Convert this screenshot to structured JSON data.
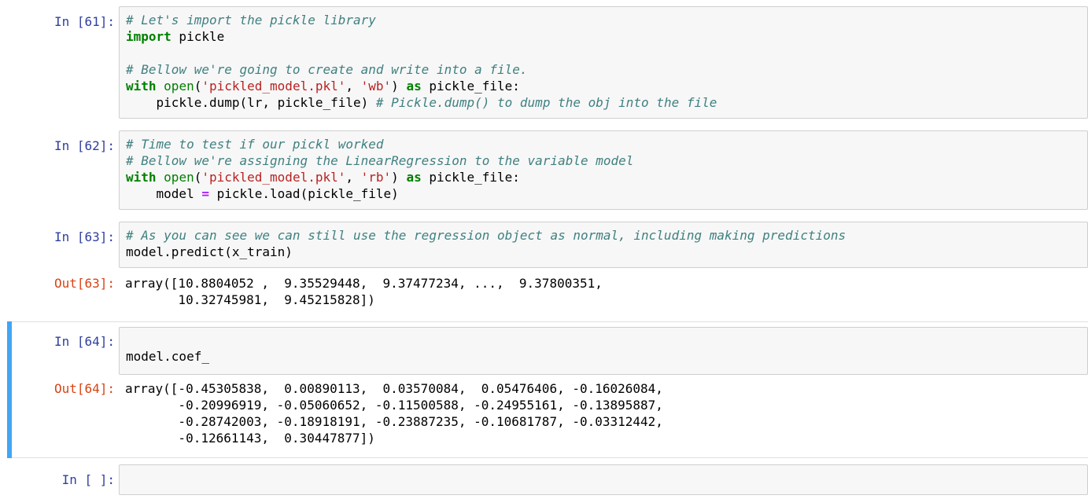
{
  "cells": [
    {
      "prompt": "In [61]:",
      "lines": [
        [
          {
            "t": "# Let's import the pickle library",
            "c": "cm"
          }
        ],
        [
          {
            "t": "import",
            "c": "kw"
          },
          {
            "t": " pickle",
            "c": ""
          }
        ],
        [],
        [
          {
            "t": "# Bellow we're going to create and write into a file.",
            "c": "cm"
          }
        ],
        [
          {
            "t": "with",
            "c": "kw"
          },
          {
            "t": " ",
            "c": ""
          },
          {
            "t": "open",
            "c": "bi"
          },
          {
            "t": "(",
            "c": ""
          },
          {
            "t": "'pickled_model.pkl'",
            "c": "st"
          },
          {
            "t": ", ",
            "c": ""
          },
          {
            "t": "'wb'",
            "c": "st"
          },
          {
            "t": ") ",
            "c": ""
          },
          {
            "t": "as",
            "c": "kw"
          },
          {
            "t": " pickle_file:",
            "c": ""
          }
        ],
        [
          {
            "t": "    pickle.dump(lr, pickle_file) ",
            "c": ""
          },
          {
            "t": "# Pickle.dump() to dump the obj into the file",
            "c": "cm"
          }
        ]
      ]
    },
    {
      "prompt": "In [62]:",
      "lines": [
        [
          {
            "t": "# Time to test if our pickl worked",
            "c": "cm"
          }
        ],
        [
          {
            "t": "# Bellow we're assigning the LinearRegression to the variable model",
            "c": "cm"
          }
        ],
        [
          {
            "t": "with",
            "c": "kw"
          },
          {
            "t": " ",
            "c": ""
          },
          {
            "t": "open",
            "c": "bi"
          },
          {
            "t": "(",
            "c": ""
          },
          {
            "t": "'pickled_model.pkl'",
            "c": "st"
          },
          {
            "t": ", ",
            "c": ""
          },
          {
            "t": "'rb'",
            "c": "st"
          },
          {
            "t": ") ",
            "c": ""
          },
          {
            "t": "as",
            "c": "kw"
          },
          {
            "t": " pickle_file:",
            "c": ""
          }
        ],
        [
          {
            "t": "    model ",
            "c": ""
          },
          {
            "t": "=",
            "c": "op"
          },
          {
            "t": " pickle.load(pickle_file)",
            "c": ""
          }
        ]
      ]
    },
    {
      "prompt": "In [63]:",
      "lines": [
        [
          {
            "t": "# As you can see we can still use the regression object as normal, including making predictions",
            "c": "cm"
          }
        ],
        [
          {
            "t": "model.predict(x_train)",
            "c": ""
          }
        ]
      ],
      "out_prompt": "Out[63]:",
      "output": "array([10.8804052 ,  9.35529448,  9.37477234, ...,  9.37800351,\n       10.32745981,  9.45215828])"
    },
    {
      "prompt": "In [64]:",
      "lines": [
        [],
        [
          {
            "t": "model.coef_",
            "c": ""
          }
        ]
      ],
      "out_prompt": "Out[64]:",
      "output": "array([-0.45305838,  0.00890113,  0.03570084,  0.05476406, -0.16026084,\n       -0.20996919, -0.05060652, -0.11500588, -0.24955161, -0.13895887,\n       -0.28742003, -0.18918191, -0.23887235, -0.10681787, -0.03312442,\n       -0.12661143,  0.30447877])"
    },
    {
      "prompt": "In [ ]:",
      "lines": []
    }
  ]
}
